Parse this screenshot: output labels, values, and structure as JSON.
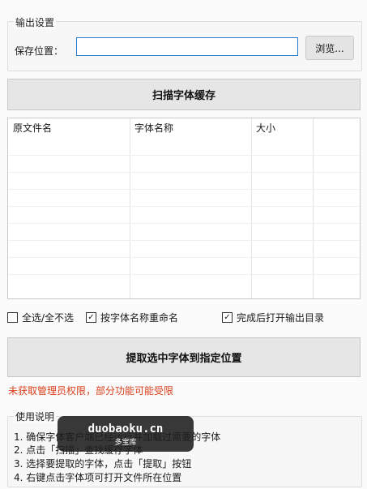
{
  "output_settings": {
    "title": "输出设置",
    "save_location_label": "保存位置：",
    "save_location_value": "",
    "browse_label": "浏览..."
  },
  "scan_button_label": "扫描字体缓存",
  "table": {
    "columns": [
      "原文件名",
      "字体名称",
      "大小"
    ],
    "rows": []
  },
  "options": {
    "select_all_label": "全选/全不选",
    "select_all_checked": false,
    "rename_label": "按字体名称重命名",
    "rename_checked": true,
    "open_dir_label": "完成后打开输出目录",
    "open_dir_checked": true
  },
  "extract_button_label": "提取选中字体到指定位置",
  "warning_text": "未获取管理员权限，部分功能可能受限",
  "help": {
    "title": "使用说明",
    "lines": [
      "1. 确保字体客户端已经运行并加载过需要的字体",
      "2. 点击「扫描」查找缓存字体",
      "3. 选择要提取的字体，点击「提取」按钮",
      "4. 右键点击字体项可打开文件所在位置"
    ]
  },
  "watermark": {
    "main": "duobaoku.cn",
    "sub": "多宝库"
  },
  "colors": {
    "accent_border": "#2a7ad0",
    "warning": "#d9401b"
  }
}
